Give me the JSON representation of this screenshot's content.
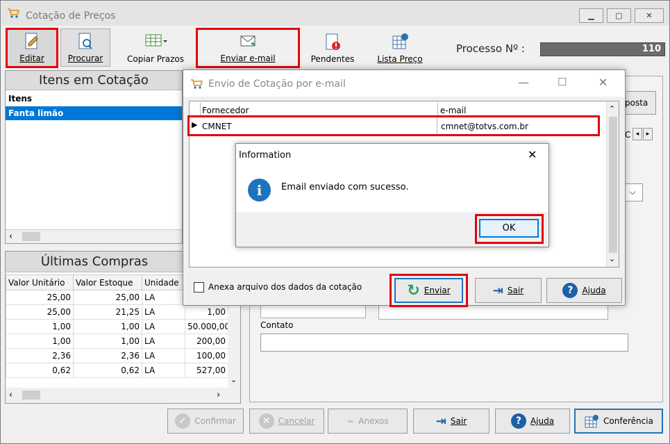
{
  "window": {
    "title": "Cotação de Preços"
  },
  "toolbar": {
    "editar": "Editar",
    "procurar": "Procurar",
    "copiar_prazos": "Copiar Prazos",
    "enviar_email": "Enviar e-mail",
    "pendentes": "Pendentes",
    "lista_preco": "Lista Preço",
    "processo_label": "Processo Nº :",
    "processo_value": "110"
  },
  "items_panel": {
    "title": "Itens em Cotação",
    "header": "Itens",
    "rows": [
      "Fanta limão"
    ]
  },
  "compras_panel": {
    "title": "Últimas Compras",
    "columns": [
      "Valor Unitário",
      "Valor Estoque",
      "Unidade",
      ""
    ],
    "rows": [
      [
        "25,00",
        "25,00",
        "LA",
        ""
      ],
      [
        "25,00",
        "21,25",
        "LA",
        "1,00"
      ],
      [
        "1,00",
        "1,00",
        "LA",
        "50.000,00"
      ],
      [
        "1,00",
        "1,00",
        "LA",
        "200,00"
      ],
      [
        "2,36",
        "2,36",
        "LA",
        "100,00"
      ],
      [
        "0,62",
        "0,62",
        "LA",
        "527,00"
      ]
    ]
  },
  "right_panel": {
    "resposta_partial": "posta",
    "c_partial": "C",
    "contato_label": "Contato"
  },
  "bottom": {
    "confirmar": "Confirmar",
    "cancelar": "Cancelar",
    "anexos": "Anexos",
    "sair": "Sair",
    "ajuda": "Ajuda",
    "conferencia": "Conferência"
  },
  "email_dialog": {
    "title": "Envio de Cotação por e-mail",
    "col_fornecedor": "Fornecedor",
    "col_email": "e-mail",
    "rows": [
      {
        "fornecedor": "CMNET",
        "email": "cmnet@totvs.com.br"
      }
    ],
    "anexa_label": "Anexa arquivo dos dados da cotação",
    "enviar": "Enviar",
    "sair": "Sair",
    "ajuda": "Ajuda"
  },
  "info_dialog": {
    "title": "Information",
    "message": "Email enviado com sucesso.",
    "ok": "OK"
  },
  "colors": {
    "highlight_red": "#e3000f",
    "selection_blue": "#0078d7",
    "info_blue": "#1e73be"
  }
}
